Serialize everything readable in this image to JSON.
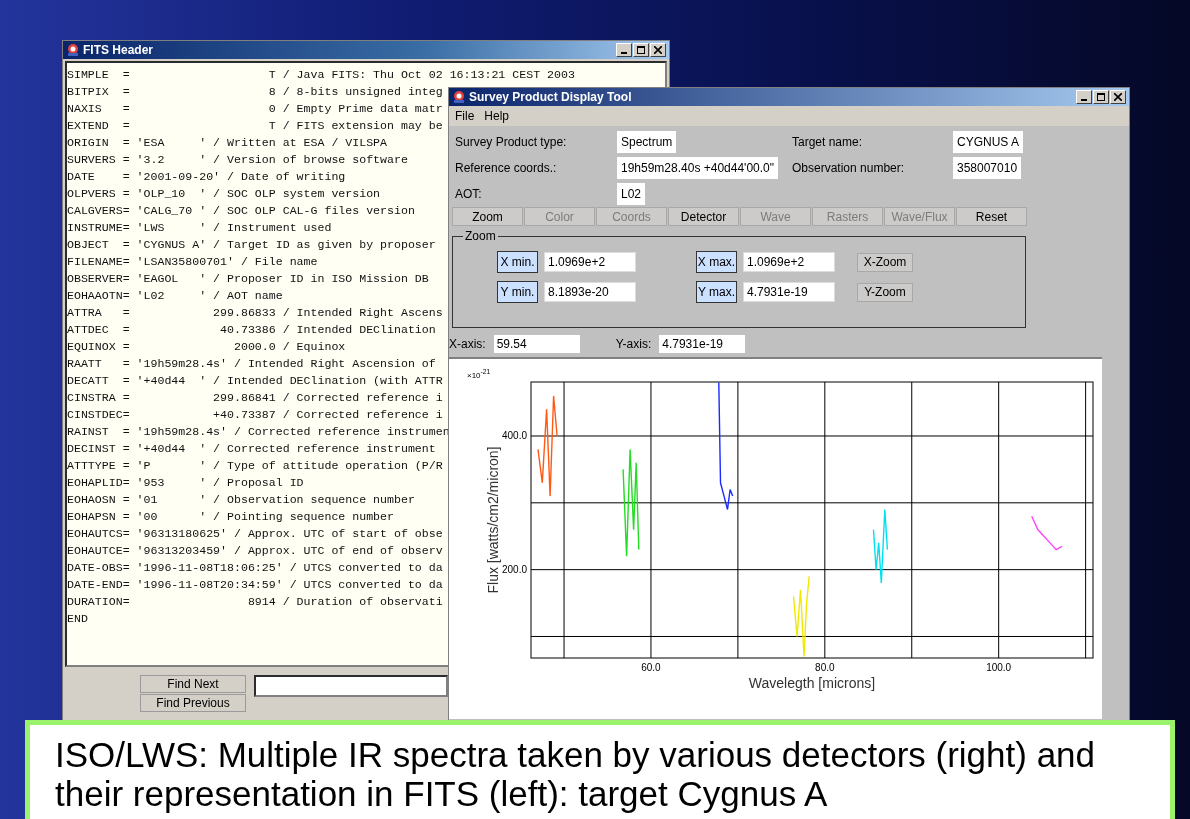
{
  "fits_window": {
    "title": "FITS Header",
    "header_lines": [
      "SIMPLE  =                    T / Java FITS: Thu Oct 02 16:13:21 CEST 2003",
      "BITPIX  =                    8 / 8-bits unsigned integ",
      "NAXIS   =                    0 / Empty Prime data matr",
      "EXTEND  =                    T / FITS extension may be",
      "ORIGIN  = 'ESA     ' / Written at ESA / VILSPA",
      "SURVERS = '3.2     ' / Version of browse software",
      "DATE    = '2001-09-20' / Date of writing",
      "OLPVERS = 'OLP_10  ' / SOC OLP system version",
      "CALGVERS= 'CALG_70 ' / SOC OLP CAL-G files version",
      "INSTRUME= 'LWS     ' / Instrument used",
      "OBJECT  = 'CYGNUS A' / Target ID as given by proposer",
      "FILENAME= 'LSAN35800701' / File name",
      "OBSERVER= 'EAGOL   ' / Proposer ID in ISO Mission DB",
      "EOHAAOTN= 'L02     ' / AOT name",
      "ATTRA   =            299.86833 / Intended Right Ascens",
      "ATTDEC  =             40.73386 / Intended DEClination",
      "EQUINOX =               2000.0 / Equinox",
      "RAATT   = '19h59m28.4s' / Intended Right Ascension of",
      "DECATT  = '+40d44  ' / Intended DEClination (with ATTR",
      "CINSTRA =            299.86841 / Corrected reference i",
      "CINSTDEC=            +40.73387 / Corrected reference i",
      "RAINST  = '19h59m28.4s' / Corrected reference instrumen",
      "DECINST = '+40d44  ' / Corrected reference instrument",
      "ATTTYPE = 'P       ' / Type of attitude operation (P/R",
      "EOHAPLID= '953     ' / Proposal ID",
      "EOHAOSN = '01      ' / Observation sequence number",
      "EOHAPSN = '00      ' / Pointing sequence number",
      "EOHAUTCS= '96313180625' / Approx. UTC of start of obse",
      "EOHAUTCE= '96313203459' / Approx. UTC of end of observ",
      "DATE-OBS= '1996-11-08T18:06:25' / UTCS converted to da",
      "DATE-END= '1996-11-08T20:34:59' / UTCS converted to da",
      "DURATION=                 8914 / Duration of observati",
      "END"
    ],
    "buttons": [
      "Find Next",
      "Find Previous"
    ]
  },
  "survey_window": {
    "title": "Survey Product Display Tool",
    "menu": [
      "File",
      "Help"
    ],
    "fields": [
      {
        "label": "Survey Product type:",
        "value": "Spectrum"
      },
      {
        "label": "Target name:",
        "value": "CYGNUS A"
      },
      {
        "label": "Reference coords.:",
        "value": "19h59m28.40s +40d44'00.0\""
      },
      {
        "label": "Observation number:",
        "value": "358007010"
      },
      {
        "label": "AOT:",
        "value": "L02"
      }
    ],
    "toolbar": [
      {
        "label": "Zoom",
        "disabled": false
      },
      {
        "label": "Color",
        "disabled": true
      },
      {
        "label": "Coords",
        "disabled": true
      },
      {
        "label": "Detector",
        "disabled": false
      },
      {
        "label": "Wave",
        "disabled": true
      },
      {
        "label": "Rasters",
        "disabled": true
      },
      {
        "label": "Wave/Flux",
        "disabled": true
      },
      {
        "label": "Reset",
        "disabled": false
      }
    ],
    "zoom_group": {
      "title": "Zoom",
      "rows": [
        {
          "min_label": "X min.",
          "min_value": "1.0969e+2",
          "max_label": "X max.",
          "max_value": "1.0969e+2",
          "button": "X-Zoom"
        },
        {
          "min_label": "Y min.",
          "min_value": "8.1893e-20",
          "max_label": "Y max.",
          "max_value": "4.7931e-19",
          "button": "Y-Zoom"
        }
      ]
    },
    "cursor": {
      "x_label": "X-axis:",
      "x_value": "59.54",
      "y_label": "Y-axis:",
      "y_value": "4.7931e-19"
    },
    "plot": {
      "y_multiplier": "×10$^{-21}$",
      "chart_data": {
        "type": "line",
        "xlabel": "Wavelegth [microns]",
        "ylabel": "Flux [watts/cm2/micron]",
        "xlim": [
          46.2,
          110.85
        ],
        "ylim": [
          67.8,
          480.8
        ],
        "xticks": [
          {
            "value": 60,
            "label": "60.0"
          },
          {
            "value": 80,
            "label": "80.0"
          },
          {
            "value": 100,
            "label": "100.0"
          }
        ],
        "yticks": [
          {
            "value": 200,
            "label": "200.0"
          },
          {
            "value": 400,
            "label": "400.0"
          }
        ],
        "grid": true,
        "x": [
          47.0,
          47.5,
          48.0,
          48.4,
          48.8,
          49.2,
          56.8,
          57.2,
          57.6,
          58.0,
          58.3,
          58.6,
          67.8,
          68.0,
          68.4,
          68.8,
          69.1,
          69.4,
          76.4,
          76.8,
          77.2,
          77.6,
          77.9,
          78.2,
          85.6,
          85.9,
          86.2,
          86.5,
          86.9,
          87.2,
          103.8,
          104.5,
          105.2,
          105.9,
          106.6,
          107.3
        ],
        "series": [
          {
            "color": "#ff5a14",
            "values": [
              380,
              330,
              440,
              310,
              460,
              400,
              null,
              null,
              null,
              null,
              null,
              null,
              null,
              null,
              null,
              null,
              null,
              null,
              null,
              null,
              null,
              null,
              null,
              null,
              null,
              null,
              null,
              null,
              null,
              null,
              null,
              null,
              null,
              null,
              null,
              null
            ]
          },
          {
            "color": "#22dd22",
            "values": [
              null,
              null,
              null,
              null,
              null,
              null,
              350,
              220,
              380,
              260,
              360,
              230,
              null,
              null,
              null,
              null,
              null,
              null,
              null,
              null,
              null,
              null,
              null,
              null,
              null,
              null,
              null,
              null,
              null,
              null,
              null,
              null,
              null,
              null,
              null,
              null
            ]
          },
          {
            "color": "#1a2aff",
            "values": [
              null,
              null,
              null,
              null,
              null,
              null,
              null,
              null,
              null,
              null,
              null,
              null,
              480,
              330,
              310,
              290,
              320,
              310,
              null,
              null,
              null,
              null,
              null,
              null,
              null,
              null,
              null,
              null,
              null,
              null,
              null,
              null,
              null,
              null,
              null,
              null
            ]
          },
          {
            "color": "#f0ea00",
            "values": [
              null,
              null,
              null,
              null,
              null,
              null,
              null,
              null,
              null,
              null,
              null,
              null,
              null,
              null,
              null,
              null,
              null,
              null,
              160,
              100,
              170,
              70,
              150,
              190,
              null,
              null,
              null,
              null,
              null,
              null,
              null,
              null,
              null,
              null,
              null,
              null
            ]
          },
          {
            "color": "#00e0f0",
            "values": [
              null,
              null,
              null,
              null,
              null,
              null,
              null,
              null,
              null,
              null,
              null,
              null,
              null,
              null,
              null,
              null,
              null,
              null,
              null,
              null,
              null,
              null,
              null,
              null,
              260,
              200,
              240,
              180,
              290,
              230,
              null,
              null,
              null,
              null,
              null,
              null
            ]
          },
          {
            "color": "#ff44ff",
            "values": [
              null,
              null,
              null,
              null,
              null,
              null,
              null,
              null,
              null,
              null,
              null,
              null,
              null,
              null,
              null,
              null,
              null,
              null,
              null,
              null,
              null,
              null,
              null,
              null,
              null,
              null,
              null,
              null,
              null,
              null,
              280,
              260,
              250,
              240,
              230,
              235
            ]
          }
        ]
      }
    }
  },
  "slide_caption": "ISO/LWS: Multiple IR spectra taken by various detectors (right) and their representation in FITS (left): target Cygnus A"
}
